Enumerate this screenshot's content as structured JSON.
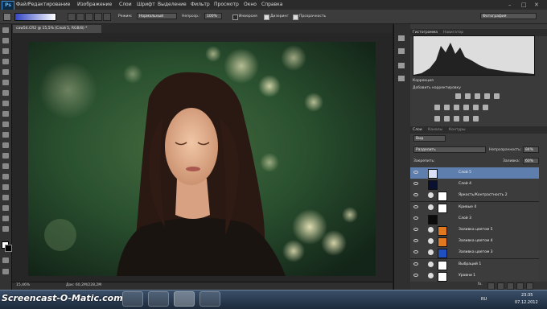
{
  "app": {
    "logo": "Ps"
  },
  "menu": [
    "Файл",
    "Редактирование",
    "Изображение",
    "Слои",
    "Шрифт",
    "Выделение",
    "Фильтр",
    "Просмотр",
    "Окно",
    "Справка"
  ],
  "options": {
    "mode_label": "Режим:",
    "mode_value": "Нормальный",
    "opacity_label": "Непрозр.:",
    "opacity_value": "100%",
    "inverse_label": "Инверсия",
    "dither_label": "Дизеринг",
    "transparency_label": "Прозрачность",
    "workspace": "Фотография"
  },
  "document": {
    "tab_title": "саw54.CR2 @ 15,5% (Слой 5, RGB/8) *",
    "zoom": "15,46%",
    "doc_info": "Док: 60,2М/228,2М"
  },
  "panels": {
    "tabs_top": [
      "Гистограмма",
      "Навигатор"
    ],
    "correction_title": "Коррекция",
    "correction_subtitle": "Добавить корректировку",
    "layer_tabs": [
      "Слои",
      "Каналы",
      "Контуры"
    ],
    "kind_label": "Вид",
    "blend_mode": "Разделить",
    "opacity_label": "Непрозрачность:",
    "opacity_value": "84%",
    "lock_label": "Закрепить:",
    "fill_label": "Заливка:",
    "fill_value": "60%"
  },
  "layers": [
    {
      "name": "Слой 5",
      "selected": true,
      "thumb": "#d9dff5",
      "adjust": false
    },
    {
      "name": "Слой 4",
      "selected": false,
      "thumb": "#0a1030",
      "adjust": false
    },
    {
      "name": "Яркость/Контрастность 2",
      "selected": false,
      "thumb": "#ffffff",
      "adjust": true
    },
    {
      "name": "Кривые 4",
      "selected": false,
      "thumb": "#ffffff",
      "adjust": true
    },
    {
      "name": "Слой 3",
      "selected": false,
      "thumb": "#0b0b0b",
      "adjust": false
    },
    {
      "name": "Заливка цветом 5",
      "selected": false,
      "thumb": "#e07820",
      "adjust": true
    },
    {
      "name": "Заливка цветом 4",
      "selected": false,
      "thumb": "#e07820",
      "adjust": true
    },
    {
      "name": "Заливка цветом 3",
      "selected": false,
      "thumb": "#2050c0",
      "adjust": true
    },
    {
      "name": "Выбраций 1",
      "selected": false,
      "thumb": "#ffffff",
      "adjust": true
    },
    {
      "name": "Уровни 1",
      "selected": false,
      "thumb": "#ffffff",
      "adjust": true
    }
  ],
  "taskbar": {
    "watermark": "Screencast-O-Matic.com",
    "lang": "RU",
    "time": "23:35",
    "date": "07.12.2012"
  },
  "colors": {
    "selection": "#5e7fae",
    "accent": "#3d8fd6"
  }
}
